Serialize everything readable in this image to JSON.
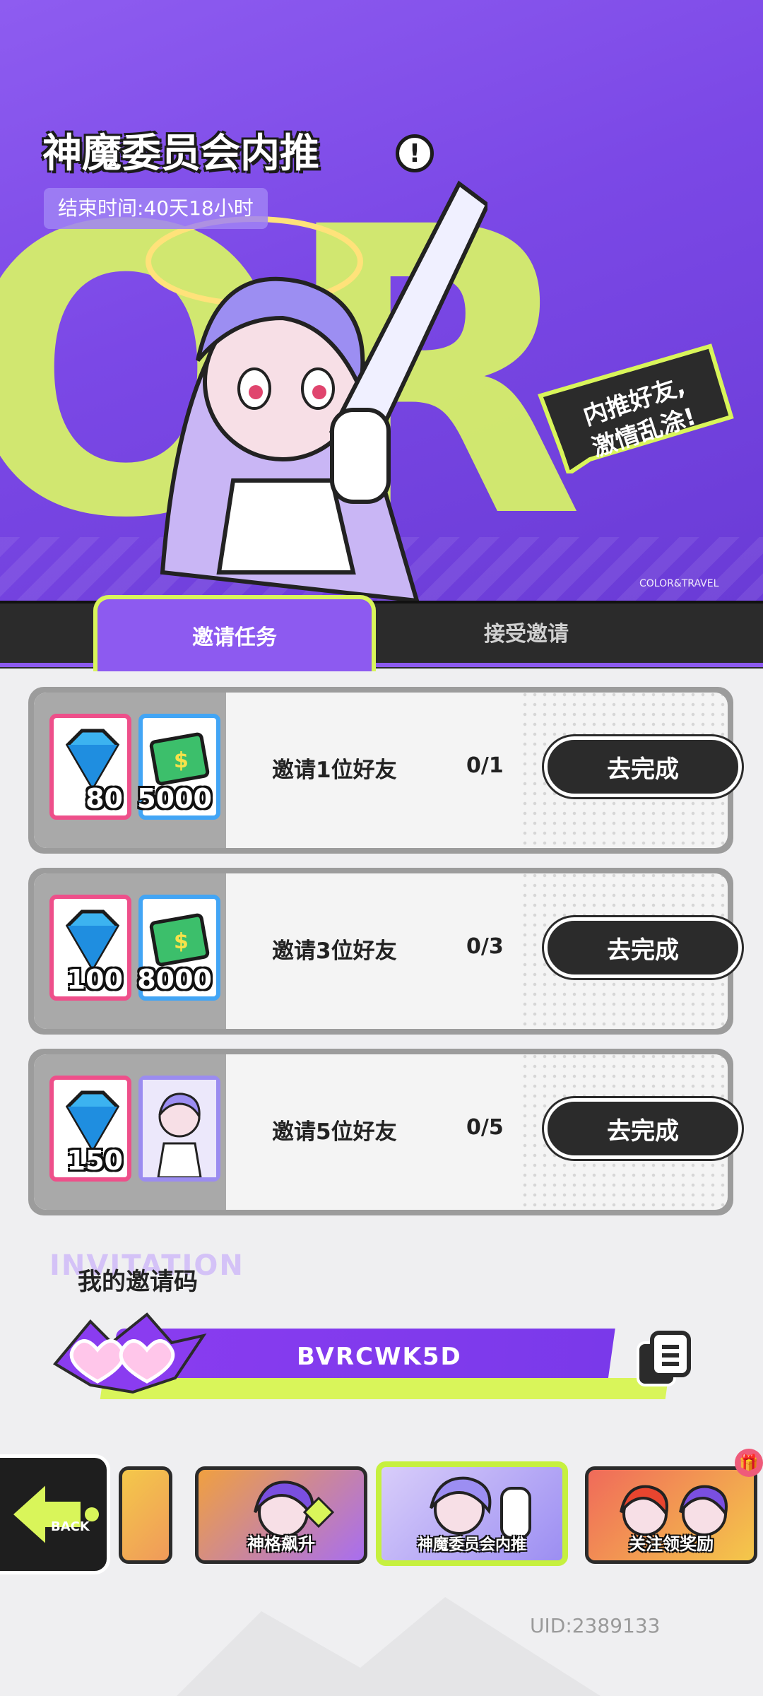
{
  "banner": {
    "title": "神魔委员会内推",
    "end_time": "结束时间:40天18小时",
    "speech_line1": "内推好友,",
    "speech_line2": "激情乱涂!",
    "brand": "COLOR&TRAVEL",
    "bg_letters": "OR"
  },
  "tabs": {
    "active": "邀请任务",
    "inactive": "接受邀请"
  },
  "tasks": [
    {
      "rewards": [
        {
          "type": "gem-icon",
          "count": "80"
        },
        {
          "type": "cash-icon",
          "count": "5000"
        }
      ],
      "label": "邀请1位好友",
      "progress": "0/1",
      "button": "去完成"
    },
    {
      "rewards": [
        {
          "type": "gem-icon",
          "count": "100"
        },
        {
          "type": "cash-icon",
          "count": "8000"
        }
      ],
      "label": "邀请3位好友",
      "progress": "0/3",
      "button": "去完成"
    },
    {
      "rewards": [
        {
          "type": "gem-icon",
          "count": "150"
        },
        {
          "type": "character-card-icon",
          "count": ""
        }
      ],
      "label": "邀请5位好友",
      "progress": "0/5",
      "button": "去完成"
    }
  ],
  "invite": {
    "watermark": "INVITATION",
    "title": "我的邀请码",
    "code": "BVRCWK5D"
  },
  "bottom_nav": {
    "back": "BACK",
    "cards": [
      {
        "label": ""
      },
      {
        "label": "神格飙升"
      },
      {
        "label": "神魔委员会内推"
      },
      {
        "label": "关注领奖励"
      }
    ]
  },
  "uid": "UID:2389133",
  "colors": {
    "purple": "#8d5af0",
    "lime": "#d9f55a",
    "dark": "#2b2b2b",
    "pink": "#ee4f8a",
    "blue": "#42a5f5"
  }
}
